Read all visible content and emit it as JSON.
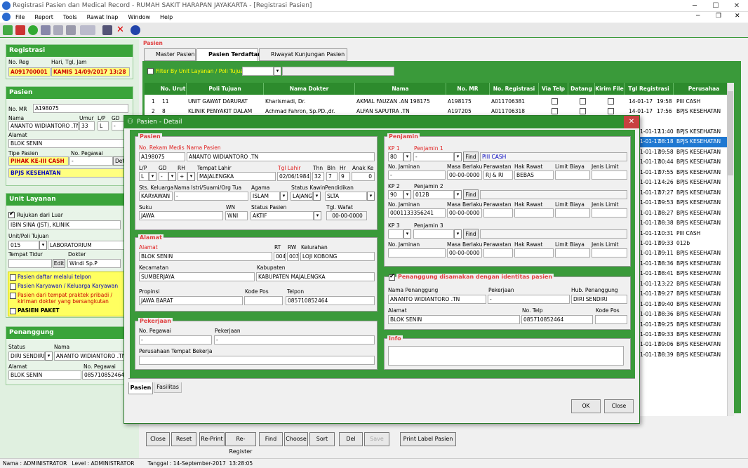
{
  "window": {
    "title": "Registrasi Pasien dan Medical Record - RUMAH SAKIT HARAPAN JAYAKARTA - [Registrasi Pasien]"
  },
  "menu": [
    "File",
    "Report",
    "Tools",
    "Rawat Inap",
    "Window",
    "Help"
  ],
  "left": {
    "registrasi": {
      "header": "Registrasi",
      "noreg_label": "No. Reg",
      "hari_label": "Hari, Tgl, Jam",
      "noreg": "A091700001",
      "hari": "KAMIS 14/09/2017 13:28"
    },
    "pasien": {
      "header": "Pasien",
      "nomr_label": "No. MR",
      "nomr": "A198075",
      "nama_label": "Nama",
      "umur_label": "Umur",
      "lp_label": "L/P",
      "gd_label": "GD",
      "nama": "ANANTO WIDIANTORO .TN",
      "umur": "33",
      "lp": "L",
      "gd": "-",
      "alamat_label": "Alamat",
      "alamat": "BLOK SENIN",
      "tipe_label": "Tipe Pasien",
      "nopeg_label": "No. Pegawai",
      "tipe": "PIHAK KE-III CASH",
      "nopeg": "-",
      "detail_btn": "Deta",
      "bpjs": "BPJS KESEHATAN"
    },
    "unit": {
      "header": "Unit Layanan",
      "rujukan_label": "Rujukan dari Luar",
      "rujukan": "IBIN SINA (JST), KLINIK",
      "unitpoli_label": "Unit/Poli Tujuan",
      "unit_code": "015",
      "unit_name": "LABORATORIUM",
      "tempat_label": "Tempat Tidur",
      "dokter_label": "Dokter",
      "edit_btn": "Edit",
      "dokter": "Windi Sp.P",
      "opt1": "Pasien daftar melalui telpon",
      "opt2": "Pasien Karyawan / Keluarga Karyawan",
      "opt3": "Pasien dari tempat praktek pribadi / kiriman dokter yang bersangkutan",
      "opt4": "PASIEN PAKET"
    },
    "penanggung": {
      "header": "Penanggung",
      "status_label": "Status",
      "nama_label": "Nama",
      "status": "DIRI SENDIRI",
      "nama": "ANANTO WIDIANTORO .TN",
      "alamat_label": "Alamat",
      "nopeg_label": "No. Pegawai",
      "alamat": "BLOK SENIN",
      "nopeg": "085710852464"
    }
  },
  "main": {
    "pasien_label": "Pasien",
    "tabs": [
      "Master Pasien",
      "Pasien Terdaftar",
      "Riwayat Kunjungan Pasien"
    ],
    "filter_label": "Filter By Unit Layanan / Poli Tujuan",
    "columns": [
      "No. Urut",
      "Poli Tujuan",
      "Nama Dokter",
      "Nama",
      "No. MR",
      "No. Registrasi",
      "Via Telp",
      "Datang",
      "Kirim File",
      "Tgl Registrasi",
      "",
      "Perusahaa"
    ],
    "rows": [
      [
        "1",
        "11",
        "UNIT GAWAT DARURAT",
        "Kharismadi, Dr.",
        "AKMAL FAUZAN .AN 198175",
        "A198175",
        "A011706381",
        "14-01-17",
        "19:58",
        "PIII CASH"
      ],
      [
        "2",
        "8",
        "KLINIK PENYAKIT DALAM",
        "Achmad Fahron, Sp.PD.,dr.",
        "ALFAN SAPUTRA .TN",
        "A197205",
        "A011706318",
        "14-01-17",
        "17:56",
        "BPJS KESEHATAN"
      ]
    ],
    "right_rows": [
      [
        "1-01-17",
        "11:40",
        "BPJS KESEHATAN"
      ],
      [
        "1-01-17",
        "08:18",
        "BPJS KESEHATAN"
      ],
      [
        "1-01-17",
        "09:58",
        "BPJS KESEHATAN"
      ],
      [
        "1-01-17",
        "00:44",
        "BPJS KESEHATAN"
      ],
      [
        "1-01-17",
        "07:55",
        "BPJS KESEHATAN"
      ],
      [
        "1-01-17",
        "14:26",
        "BPJS KESEHATAN"
      ],
      [
        "1-01-17",
        "07:27",
        "BPJS KESEHATAN"
      ],
      [
        "1-01-17",
        "09:53",
        "BPJS KESEHATAN"
      ],
      [
        "1-01-17",
        "08:27",
        "BPJS KESEHATAN"
      ],
      [
        "1-01-17",
        "08:38",
        "BPJS KESEHATAN"
      ],
      [
        "1-01-17",
        "10:31",
        "PIII CASH"
      ],
      [
        "1-01-17",
        "09:33",
        "012b"
      ],
      [
        "1-01-17",
        "09:11",
        "BPJS KESEHATAN"
      ],
      [
        "1-01-17",
        "08:36",
        "BPJS KESEHATAN"
      ],
      [
        "1-01-17",
        "08:41",
        "BPJS KESEHATAN"
      ],
      [
        "1-01-17",
        "13:22",
        "BPJS KESEHATAN"
      ],
      [
        "1-01-17",
        "09:27",
        "BPJS KESEHATAN"
      ],
      [
        "1-01-17",
        "09:40",
        "BPJS KESEHATAN"
      ],
      [
        "1-01-17",
        "08:36",
        "BPJS KESEHATAN"
      ],
      [
        "1-01-17",
        "09:25",
        "BPJS KESEHATAN"
      ],
      [
        "1-01-17",
        "09:33",
        "BPJS KESEHATAN"
      ],
      [
        "1-01-17",
        "09:06",
        "BPJS KESEHATAN"
      ],
      [
        "1-01-17",
        "08:39",
        "BPJS KESEHATAN"
      ]
    ],
    "buttons": [
      "Close",
      "Reset",
      "Re-Print",
      "Re-Register",
      "Find",
      "Choose",
      "Sort",
      "Del",
      "Save",
      "Print Label Pasien"
    ]
  },
  "dialog": {
    "title": "Pasien - Detail",
    "pasien": {
      "header": "Pasien",
      "norm_label": "No. Rekam Medis",
      "nama_label": "Nama Pasien",
      "norm": "A198075",
      "nama": "ANANTO WIDIANTORO .TN",
      "lp_label": "L/P",
      "gd_label": "GD",
      "rh_label": "RH",
      "tmp_label": "Tempat Lahir",
      "tgl_label": "Tgl Lahir",
      "thn_label": "Thn",
      "bln_label": "Bln",
      "hr_label": "Hr",
      "anak_label": "Anak Ke",
      "lp": "L",
      "gd": "-",
      "rh": "+",
      "tmp": "MAJALENGKA",
      "tgl": "02/06/1984",
      "thn": "32",
      "bln": "7",
      "hr": "9",
      "anak": "0",
      "sts_label": "Sts. Keluarga",
      "istri_label": "Nama Istri/Suami/Org Tua",
      "agama_label": "Agama",
      "kawin_label": "Status Kawin",
      "pend_label": "Pendidikan",
      "sts": "KARYAWAN",
      "istri": "-",
      "agama": "ISLAM",
      "kawin": "LAJANG",
      "pend": "SLTA",
      "suku_label": "Suku",
      "wn_label": "WN",
      "stpas_label": "Status Pasien",
      "wafat_label": "Tgl. Wafat",
      "suku": "JAWA",
      "wn": "WNI",
      "stpas": "AKTIF",
      "wafat": "00-00-0000"
    },
    "alamat": {
      "header": "Alamat",
      "alamat_label": "Alamat",
      "rt_label": "RT",
      "rw_label": "RW",
      "kel_label": "Kelurahan",
      "alamat": "BLOK SENIN",
      "rt": "004",
      "rw": "003",
      "kel": "LOJI KOBONG",
      "kec_label": "Kecamatan",
      "kab_label": "Kabupaten",
      "kec": "SUMBERJAYA",
      "kab": "KABUPATEN MAJALENGKA",
      "prov_label": "Propinsi",
      "kp_label": "Kode Pos",
      "tel_label": "Telpon",
      "prov": "JAWA BARAT",
      "kp": "",
      "tel": "085710852464"
    },
    "pekerjaan": {
      "header": "Pekerjaan",
      "nopeg_label": "No. Pegawai",
      "pek_label": "Pekerjaan",
      "nopeg": "-",
      "pek": "-",
      "per_label": "Perusahaan Tempat Bekerja"
    },
    "penjamin": {
      "header": "Penjamin",
      "kp1_label": "KP 1",
      "pj1_label": "Penjamin 1",
      "kp1": "80",
      "pj1": "-",
      "find": "Find",
      "pj1_name": "PIII CASH",
      "nojam_label": "No. Jaminan",
      "masa_label": "Masa Berlaku",
      "rawat_label": "Perawatan",
      "hak_label": "Hak Rawat",
      "limit_label": "Limit Biaya",
      "jenis_label": "Jenis Limit",
      "nojam1": "-",
      "masa1": "00-00-0000",
      "rawat1": "RJ & RI",
      "hak1": "BEBAS",
      "kp2_label": "KP 2",
      "pj2_label": "Penjamin 2",
      "kp2": "90",
      "pj2": "012B",
      "nojam2": "0001133356241",
      "masa2": "00-00-0000",
      "kp3_label": "KP 3",
      "pj3_label": "Penjamin 3",
      "masa3": "00-00-0000"
    },
    "png": {
      "header": "Penanggung disamakan dengan identitas pasien",
      "nama_label": "Nama Penanggung",
      "pek_label": "Pekerjaan",
      "hub_label": "Hub. Penanggung",
      "nama": "ANANTO WIDIANTORO .TN",
      "pek": "-",
      "hub": "DIRI SENDIRI",
      "alamat_label": "Alamat",
      "telp_label": "No. Telp",
      "kp_label": "Kode Pos",
      "alamat": "BLOK SENIN",
      "telp": "085710852464"
    },
    "info": {
      "header": "Info"
    },
    "tabs": [
      "Pasien",
      "Fasilitas"
    ],
    "ok": "OK",
    "close": "Close"
  },
  "status": {
    "text": "Nama : ADMINISTRATOR   Level : ADMINISTRATOR        Tanggal : 14-September-2017  13:28:05"
  }
}
